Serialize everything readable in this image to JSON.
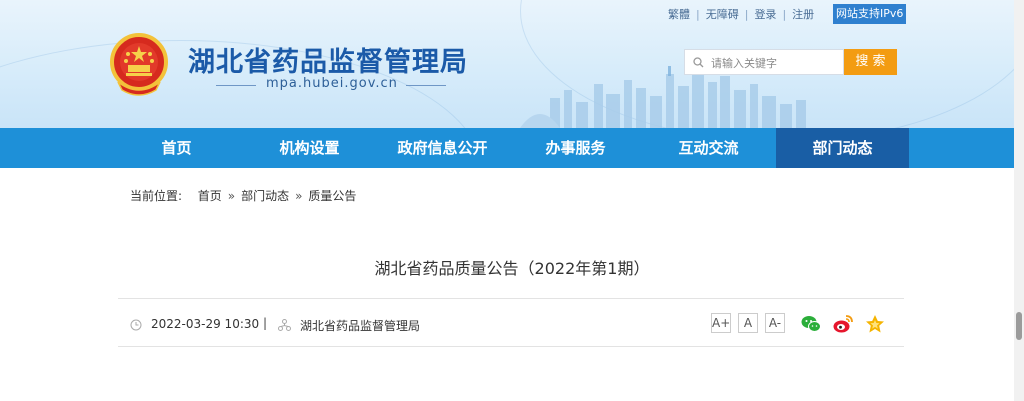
{
  "header": {
    "site_title": "湖北省药品监督管理局",
    "site_domain": "mpa.hubei.gov.cn",
    "top_links": [
      "繁體",
      "无障碍",
      "登录",
      "注册"
    ],
    "ipv6_badge": "网站支持IPv6",
    "search": {
      "placeholder": "请输入关键字",
      "button_label": "搜 索"
    }
  },
  "nav": {
    "items": [
      {
        "label": "首页"
      },
      {
        "label": "机构设置"
      },
      {
        "label": "政府信息公开"
      },
      {
        "label": "办事服务"
      },
      {
        "label": "互动交流"
      },
      {
        "label": "部门动态"
      }
    ],
    "active_index": 5
  },
  "breadcrumb": {
    "prefix": "当前位置:",
    "items": [
      "首页",
      "部门动态",
      "质量公告"
    ],
    "separator": "»"
  },
  "article": {
    "title": "湖北省药品质量公告（2022年第1期）",
    "date": "2022-03-29 10:30",
    "separator": "|",
    "source": "湖北省药品监督管理局",
    "font_sizes": [
      "A+",
      "A",
      "A-"
    ]
  },
  "colors": {
    "nav_bg": "#1e90d8",
    "nav_active": "#195ea5",
    "title_blue": "#1b5aa8",
    "search_button": "#f39c12"
  },
  "icons": [
    "national-emblem-icon",
    "search-icon",
    "clock-icon",
    "organization-icon",
    "wechat-icon",
    "weibo-icon",
    "favorite-star-icon"
  ]
}
